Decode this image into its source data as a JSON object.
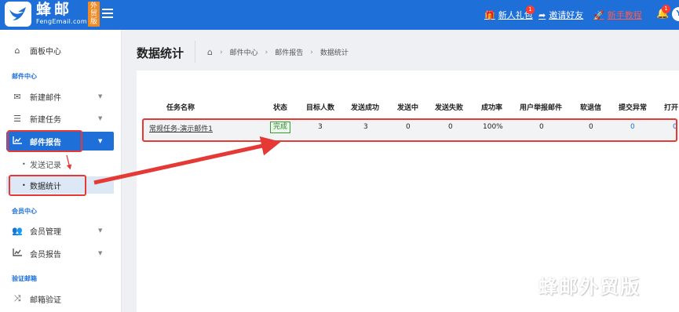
{
  "brand": {
    "name": "蜂邮",
    "domain": "FengEmail.com",
    "tag": "外贸版"
  },
  "topbar": {
    "gift_label": "新人礼包",
    "gift_badge": "1",
    "invite_label": "邀请好友",
    "tutorial_label": "新手教程",
    "bell_badge": "1",
    "avatar_text": "Y"
  },
  "sidebar": {
    "dashboard": "面板中心",
    "section_mail": "邮件中心",
    "new_mail": "新建邮件",
    "new_task": "新建任务",
    "mail_report": "邮件报告",
    "send_records": "发送记录",
    "data_stats": "数据统计",
    "section_member": "会员中心",
    "member_manage": "会员管理",
    "member_report": "会员报告",
    "section_verify": "验证邮箱",
    "mailbox_verify": "邮箱验证"
  },
  "page": {
    "title": "数据统计",
    "breadcrumb": [
      "邮件中心",
      "邮件报告",
      "数据统计"
    ]
  },
  "table": {
    "headers": [
      "任务名称",
      "状态",
      "目标人数",
      "发送成功",
      "发送中",
      "发送失败",
      "成功率",
      "用户举报邮件",
      "软退信",
      "提交异常",
      "打开"
    ],
    "rows": [
      {
        "task_name": "常规任务-演示邮件1",
        "status": "完成",
        "target": "3",
        "sent_ok": "3",
        "sending": "0",
        "failed": "0",
        "success_rate": "100%",
        "reports": "0",
        "soft_bounce": "0",
        "submit_error": "0",
        "opens": "0"
      }
    ]
  },
  "watermark": "蜂邮外贸版",
  "colors": {
    "primary": "#1e6fd8",
    "highlight": "#e53935",
    "status_green": "#2c8a2c",
    "brand_orange": "#f08a24"
  }
}
